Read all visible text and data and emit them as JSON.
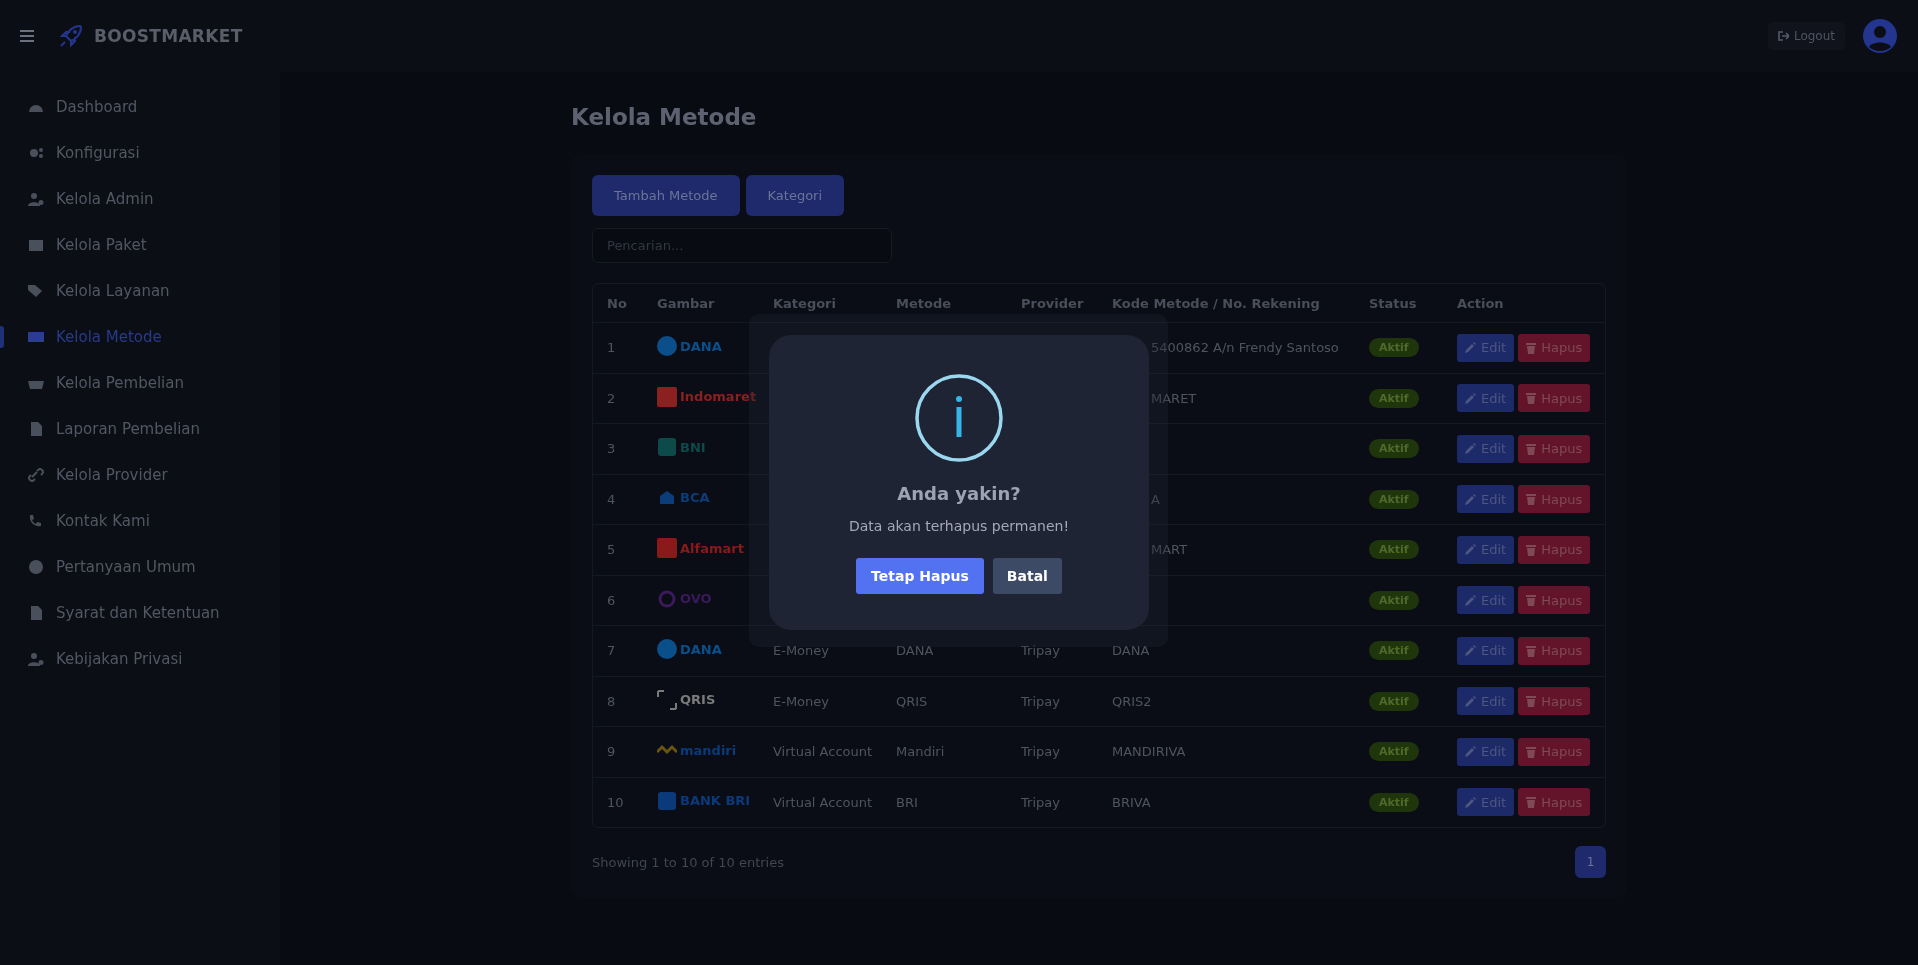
{
  "header": {
    "brand": "BOOSTMARKET",
    "logout": "Logout"
  },
  "sidebar": {
    "items": [
      {
        "label": "Dashboard",
        "selected": false
      },
      {
        "label": "Konfigurasi",
        "selected": false
      },
      {
        "label": "Kelola Admin",
        "selected": false
      },
      {
        "label": "Kelola Paket",
        "selected": false
      },
      {
        "label": "Kelola Layanan",
        "selected": false
      },
      {
        "label": "Kelola Metode",
        "selected": true
      },
      {
        "label": "Kelola Pembelian",
        "selected": false
      },
      {
        "label": "Laporan Pembelian",
        "selected": false
      },
      {
        "label": "Kelola Provider",
        "selected": false
      },
      {
        "label": "Kontak Kami",
        "selected": false
      },
      {
        "label": "Pertanyaan Umum",
        "selected": false
      },
      {
        "label": "Syarat dan Ketentuan",
        "selected": false
      },
      {
        "label": "Kebijakan Privasi",
        "selected": false
      }
    ]
  },
  "page_title": "Kelola Metode",
  "buttons": [
    "Tambah Metode",
    "Kategori"
  ],
  "search": {
    "placeholder": "Pencarian..."
  },
  "table": {
    "columns": [
      "No",
      "Gambar",
      "Kategori",
      "Metode",
      "Provider",
      "Kode Metode / No. Rekening",
      "Status",
      "Action"
    ],
    "rows": [
      {
        "no": "1",
        "logo": {
          "kind": "dana",
          "text": "DANA"
        },
        "kode": "5400862 A/n Frendy Santoso",
        "kode_cut": true,
        "status": "Aktif",
        "edit": "Edit",
        "hapus": "Hapus"
      },
      {
        "no": "2",
        "logo": {
          "kind": "indomaret",
          "text": "Indomaret"
        },
        "kode": "MARET",
        "kode_cut": true,
        "status": "Aktif",
        "edit": "Edit",
        "hapus": "Hapus"
      },
      {
        "no": "3",
        "logo": {
          "kind": "bni",
          "text": "BNI"
        },
        "status": "Aktif",
        "edit": "Edit",
        "hapus": "Hapus"
      },
      {
        "no": "4",
        "logo": {
          "kind": "bca",
          "text": "BCA"
        },
        "kode": "A",
        "kode_cut": true,
        "status": "Aktif",
        "edit": "Edit",
        "hapus": "Hapus"
      },
      {
        "no": "5",
        "logo": {
          "kind": "alfamart",
          "text": "Alfamart"
        },
        "kode": "MART",
        "kode_cut": true,
        "status": "Aktif",
        "edit": "Edit",
        "hapus": "Hapus"
      },
      {
        "no": "6",
        "logo": {
          "kind": "ovo",
          "text": "OVO"
        },
        "status": "Aktif",
        "edit": "Edit",
        "hapus": "Hapus"
      },
      {
        "no": "7",
        "logo": {
          "kind": "dana",
          "text": "DANA"
        },
        "kategori": "E-Money",
        "metode": "DANA",
        "provider": "Tripay",
        "kode": "DANA",
        "kode_cut": false,
        "status": "Aktif",
        "edit": "Edit",
        "hapus": "Hapus"
      },
      {
        "no": "8",
        "logo": {
          "kind": "qris",
          "text": "QRIS"
        },
        "kategori": "E-Money",
        "metode": "QRIS",
        "provider": "Tripay",
        "kode": "QRIS2",
        "kode_cut": false,
        "status": "Aktif",
        "edit": "Edit",
        "hapus": "Hapus"
      },
      {
        "no": "9",
        "logo": {
          "kind": "mandiri",
          "text": "mandiri"
        },
        "kategori": "Virtual Account",
        "metode": "Mandiri",
        "provider": "Tripay",
        "kode": "MANDIRIVA",
        "kode_cut": false,
        "status": "Aktif",
        "edit": "Edit",
        "hapus": "Hapus"
      },
      {
        "no": "10",
        "logo": {
          "kind": "bri",
          "text": "BANK BRI"
        },
        "kategori": "Virtual Account",
        "metode": "BRI",
        "provider": "Tripay",
        "kode": "BRIVA",
        "kode_cut": false,
        "status": "Aktif",
        "edit": "Edit",
        "hapus": "Hapus"
      }
    ]
  },
  "footer": {
    "info": "Showing 1 to 10 of 10 entries",
    "pages": [
      {
        "label": "1",
        "selected": true
      }
    ]
  },
  "dialog": {
    "title": "Anda yakin?",
    "text": "Data akan terhapus permanen!",
    "confirm": "Tetap Hapus",
    "cancel": "Batal"
  }
}
